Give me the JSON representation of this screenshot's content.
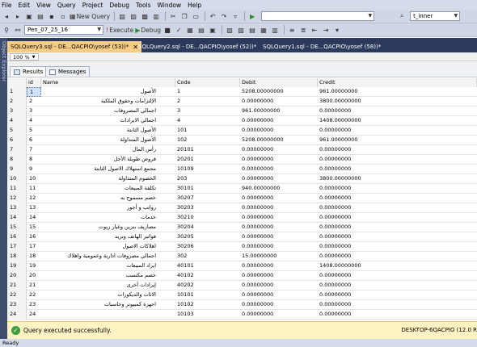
{
  "menu": [
    "File",
    "Edit",
    "View",
    "Query",
    "Project",
    "Debug",
    "Tools",
    "Window",
    "Help"
  ],
  "toolbar": {
    "new_query_label": "New Query",
    "right_combo_value": "t_inner"
  },
  "toolbar2": {
    "database_value": "Pen_07_25_16",
    "execute_label": "Execute",
    "debug_label": "Debug"
  },
  "object_explorer_label": "Object Explorer",
  "tabs": [
    {
      "label": "SQLQuery3.sql - DE...QACPIO\\yosef (53))*",
      "active": true
    },
    {
      "label": "SQLQuery2.sql - DE...QACPIO\\yosef (52))*",
      "active": false
    },
    {
      "label": "SQLQuery1.sql - DE...QACPIO\\yosef (58))*",
      "active": false
    }
  ],
  "zoom": "100 %",
  "result_tabs": {
    "results": "Results",
    "messages": "Messages"
  },
  "grid": {
    "columns": [
      "id",
      "Name",
      "Code",
      "Debit",
      "Credit"
    ],
    "rows": [
      [
        "1",
        "1",
        "الأصول",
        "1",
        "5208.00000000",
        "961.00000000"
      ],
      [
        "2",
        "2",
        "الإلتزامات وحقوق الملكية",
        "2",
        "0.00000000",
        "3800.00000000"
      ],
      [
        "3",
        "3",
        "اجمالي المصروفات",
        "3",
        "961.00000000",
        "0.00000000"
      ],
      [
        "4",
        "4",
        "اجمالي الايرادات",
        "4",
        "0.00000000",
        "1408.00000000"
      ],
      [
        "5",
        "5",
        "الأصول الثابتة",
        "101",
        "0.00000000",
        "0.00000000"
      ],
      [
        "6",
        "6",
        "الأصول المتداولة",
        "102",
        "5208.00000000",
        "961.00000000"
      ],
      [
        "7",
        "7",
        "رأس المال",
        "20101",
        "0.00000000",
        "0.00000000"
      ],
      [
        "8",
        "8",
        "قروض طويلة الأجل",
        "20201",
        "0.00000000",
        "0.00000000"
      ],
      [
        "9",
        "9",
        "مجمع استهلاك الاصول الثابتة",
        "10109",
        "0.00000000",
        "0.00000000"
      ],
      [
        "10",
        "10",
        "الخصوم المتداولة",
        "203",
        "0.00000000",
        "3800.00000000"
      ],
      [
        "11",
        "11",
        "تكلفة المبيعات",
        "30101",
        "940.00000000",
        "0.00000000"
      ],
      [
        "12",
        "12",
        "خصم مسموح به",
        "30207",
        "0.00000000",
        "0.00000000"
      ],
      [
        "13",
        "13",
        "رواتب و أجور",
        "30203",
        "0.00000000",
        "0.00000000"
      ],
      [
        "14",
        "14",
        "خدمات",
        "30210",
        "0.00000000",
        "0.00000000"
      ],
      [
        "15",
        "15",
        "مصاريف بنزين وغيار زيوت",
        "30204",
        "0.00000000",
        "0.00000000"
      ],
      [
        "16",
        "16",
        "فواتير الهاتف وبريد",
        "30205",
        "0.00000000",
        "0.00000000"
      ],
      [
        "17",
        "17",
        "اهلاكات الاصول",
        "30206",
        "0.00000000",
        "0.00000000"
      ],
      [
        "18",
        "18",
        "اجمالي مصروفات ادارية وعمومية واهلاك",
        "302",
        "15.00000000",
        "0.00000000"
      ],
      [
        "19",
        "19",
        "ايراد المبيعات",
        "40101",
        "0.00000000",
        "1408.00000000"
      ],
      [
        "20",
        "20",
        "خصم مكتسب",
        "40102",
        "0.00000000",
        "0.00000000"
      ],
      [
        "21",
        "21",
        "إيرادات أخرى",
        "40202",
        "0.00000000",
        "0.00000000"
      ],
      [
        "22",
        "22",
        "الاثاث والديكورات",
        "10101",
        "0.00000000",
        "0.00000000"
      ],
      [
        "23",
        "23",
        "اجهزة كمبيوتر وحاسبات",
        "10102",
        "0.00000000",
        "0.00000000"
      ],
      [
        "24",
        "24",
        "",
        "10103",
        "0.00000000",
        "0.00000000"
      ]
    ]
  },
  "status": {
    "message": "Query executed successfully.",
    "server": "DESKTOP-6QACPIO (12.0 R"
  },
  "app_status": "Ready"
}
